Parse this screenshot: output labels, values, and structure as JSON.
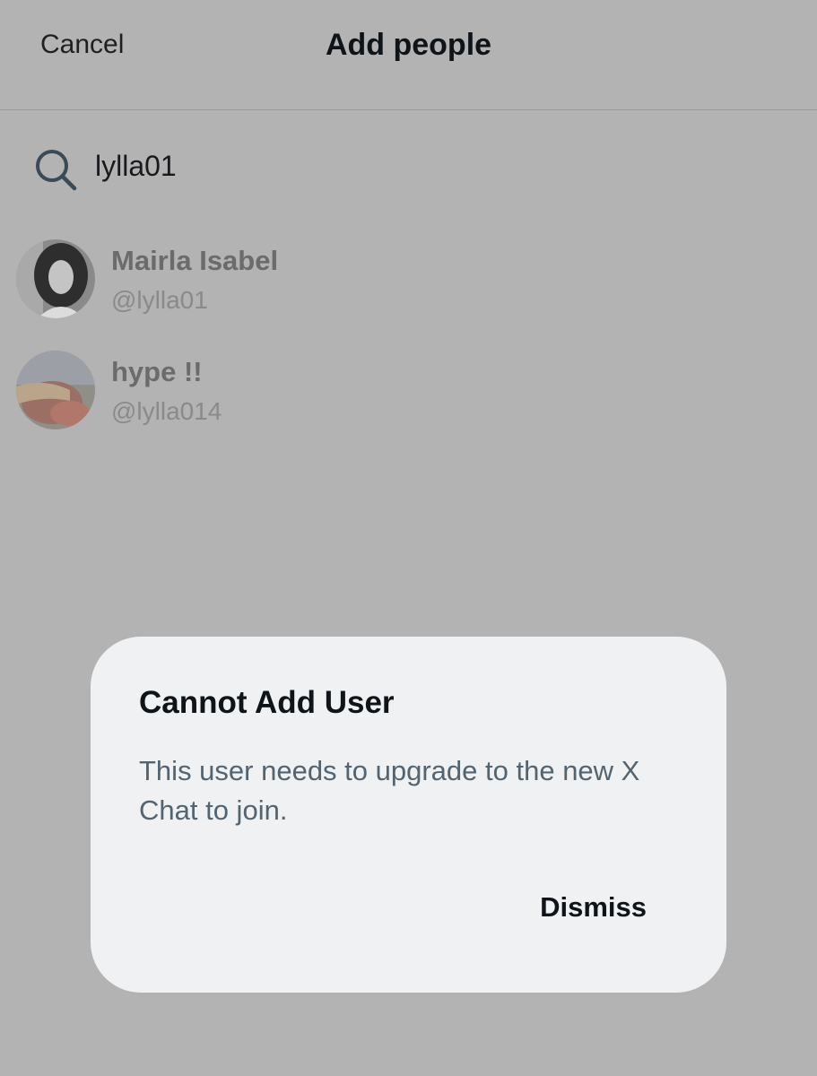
{
  "header": {
    "cancel_label": "Cancel",
    "title": "Add people"
  },
  "search": {
    "value": "lylla01",
    "icon": "search-icon"
  },
  "results": [
    {
      "name": "Mairla Isabel",
      "handle": "@lylla01",
      "avatar": "avatar-photo"
    },
    {
      "name": "hype !!",
      "handle": "@lylla014",
      "avatar": "avatar-photo"
    }
  ],
  "dialog": {
    "title": "Cannot Add User",
    "message": "This user needs to upgrade to the new X Chat to join.",
    "dismiss_label": "Dismiss"
  },
  "colors": {
    "overlay_background": "#b3b3b3",
    "dialog_background": "#eff1f3",
    "primary_text": "#0f1419",
    "secondary_text": "#536471"
  }
}
